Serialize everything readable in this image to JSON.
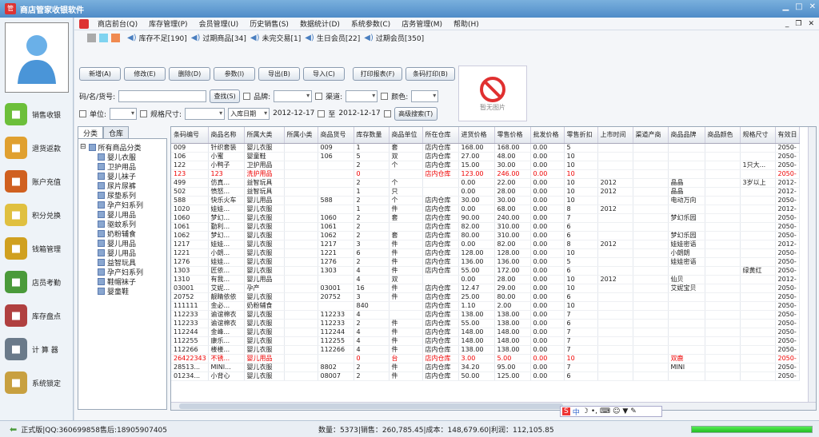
{
  "window": {
    "title": "商店管家收银软件"
  },
  "sidebar": {
    "items": [
      {
        "label": "销售收银",
        "icon": "sale-icon",
        "color": "#6cbf3a"
      },
      {
        "label": "退货返款",
        "icon": "boxes-icon",
        "color": "#e0a030"
      },
      {
        "label": "账户充值",
        "icon": "card-icon",
        "color": "#d06020"
      },
      {
        "label": "积分兑换",
        "icon": "pencil-icon",
        "color": "#e0c040"
      },
      {
        "label": "钱箱管理",
        "icon": "coins-icon",
        "color": "#d0a020"
      },
      {
        "label": "店员考勤",
        "icon": "people-icon",
        "color": "#4a9a3a"
      },
      {
        "label": "库存盘点",
        "icon": "house-icon",
        "color": "#b04040"
      },
      {
        "label": "计 算 器",
        "icon": "calculator-icon",
        "color": "#6a7a8a"
      },
      {
        "label": "系统锁定",
        "icon": "lock-icon",
        "color": "#c8a040"
      }
    ]
  },
  "menu": [
    "商店前台(Q)",
    "库存管理(P)",
    "会员管理(U)",
    "历史销售(S)",
    "数据统计(D)",
    "系统参数(C)",
    "店务管理(M)",
    "帮助(H)"
  ],
  "alerts": [
    "库存不足[190]",
    "过期商品[34]",
    "未完交易[1]",
    "生日会员[22]",
    "过期会员[350]"
  ],
  "toolbar": {
    "buttons": [
      "新增(A)",
      "修改(E)",
      "删除(D)",
      "参数(I)",
      "导出(B)",
      "导入(C)"
    ],
    "print_report": "打印报表(F)",
    "print_barcode": "条码打印(B)"
  },
  "filters": {
    "code_label": "码/名/货号:",
    "search": "查找(S)",
    "brand": "品牌:",
    "channel": "渠道:",
    "color": "颜色:",
    "unit": "单位:",
    "size": "规格尺寸:",
    "date_type": "入库日期",
    "date_from": "2012-12-17",
    "to": "至",
    "date_to": "2012-12-17",
    "advanced": "高级搜索(T)"
  },
  "big_icon_label": "暂无图片",
  "tabs": [
    "分类",
    "仓库"
  ],
  "tree": {
    "root": "所有商品分类",
    "children": [
      "婴儿衣服",
      "卫护用品",
      "婴儿袜子",
      "尿片尿裤",
      "尿垫系列",
      "孕产妇系列",
      "婴儿用品",
      "驱蚊系列",
      "奶粉辅食",
      "婴儿用品",
      "婴儿用品",
      "益智玩具",
      "孕产妇系列",
      "鞋帽袜子",
      "婴童鞋"
    ]
  },
  "table": {
    "headers": [
      "条码编号",
      "商品名称",
      "所属大类",
      "所属小类",
      "商品货号",
      "库存数量",
      "商品单位",
      "所在仓库",
      "进货价格",
      "零售价格",
      "批发价格",
      "零售折扣",
      "上市时间",
      "渠道产商",
      "商品品牌",
      "商品颜色",
      "规格尺寸",
      "有效日"
    ],
    "rows": [
      [
        "009",
        "针织套装",
        "婴儿衣服",
        "",
        "009",
        "1",
        "套",
        "店内仓库",
        "168.00",
        "168.00",
        "0.00",
        "5",
        "",
        "",
        "",
        "",
        "",
        "2050-"
      ],
      [
        "106",
        "小蜜",
        "婴童鞋",
        "",
        "106",
        "5",
        "双",
        "店内仓库",
        "27.00",
        "48.00",
        "0.00",
        "10",
        "",
        "",
        "",
        "",
        "",
        "2050-"
      ],
      [
        "122",
        "小鸭子",
        "卫护用品",
        "",
        "",
        "2",
        "个",
        "店内仓库",
        "15.00",
        "30.00",
        "0.00",
        "10",
        "",
        "",
        "",
        "",
        "1只大...",
        "2050-"
      ],
      [
        "123",
        "123",
        "洗护用品",
        "",
        "",
        "0",
        "",
        "店内仓库",
        "123.00",
        "246.00",
        "0.00",
        "10",
        "",
        "",
        "",
        "",
        "",
        "2050-"
      ],
      [
        "499",
        "仿真...",
        "益智玩具",
        "",
        "",
        "2",
        "个",
        "",
        "0.00",
        "22.00",
        "0.00",
        "10",
        "2012",
        "",
        "晶晶",
        "",
        "3岁以上",
        "2012-"
      ],
      [
        "502",
        "愤怒...",
        "益智玩具",
        "",
        "",
        "1",
        "只",
        "",
        "0.00",
        "28.00",
        "0.00",
        "10",
        "2012",
        "",
        "晶晶",
        "",
        "",
        "2012-"
      ],
      [
        "588",
        "快乐火车",
        "婴儿用品",
        "",
        "588",
        "2",
        "个",
        "店内仓库",
        "30.00",
        "30.00",
        "0.00",
        "10",
        "",
        "",
        "电动万向",
        "",
        "",
        "2050-"
      ],
      [
        "1020",
        "娃娃...",
        "婴儿衣服",
        "",
        "",
        "1",
        "件",
        "店内仓库",
        "0.00",
        "68.00",
        "0.00",
        "8",
        "2012",
        "",
        "",
        "",
        "",
        "2012-"
      ],
      [
        "1060",
        "梦幻...",
        "婴儿衣服",
        "",
        "1060",
        "2",
        "套",
        "店内仓库",
        "90.00",
        "240.00",
        "0.00",
        "7",
        "",
        "",
        "梦幻乐园",
        "",
        "",
        "2050-"
      ],
      [
        "1061",
        "勤利...",
        "婴儿衣服",
        "",
        "1061",
        "2",
        "",
        "店内仓库",
        "82.00",
        "310.00",
        "0.00",
        "6",
        "",
        "",
        "",
        "",
        "",
        "2050-"
      ],
      [
        "1062",
        "梦幻...",
        "婴儿衣服",
        "",
        "1062",
        "2",
        "套",
        "店内仓库",
        "80.00",
        "310.00",
        "0.00",
        "6",
        "",
        "",
        "梦幻乐园",
        "",
        "",
        "2050-"
      ],
      [
        "1217",
        "娃娃...",
        "婴儿衣服",
        "",
        "1217",
        "3",
        "件",
        "店内仓库",
        "0.00",
        "82.00",
        "0.00",
        "8",
        "2012",
        "",
        "娃娃密语",
        "",
        "",
        "2012-"
      ],
      [
        "1221",
        "小朗...",
        "婴儿衣服",
        "",
        "1221",
        "6",
        "件",
        "店内仓库",
        "128.00",
        "128.00",
        "0.00",
        "10",
        "",
        "",
        "小朗朗",
        "",
        "",
        "2050-"
      ],
      [
        "1276",
        "娃娃...",
        "婴儿衣服",
        "",
        "1276",
        "2",
        "件",
        "店内仓库",
        "136.00",
        "136.00",
        "0.00",
        "5",
        "",
        "",
        "娃娃密语",
        "",
        "",
        "2050-"
      ],
      [
        "1303",
        "匠依...",
        "婴儿衣服",
        "",
        "1303",
        "4",
        "件",
        "店内仓库",
        "55.00",
        "172.00",
        "0.00",
        "6",
        "",
        "",
        "",
        "",
        "绿黄红",
        "2050-"
      ],
      [
        "1310",
        "有我...",
        "婴儿用品",
        "",
        "",
        "4",
        "双",
        "",
        "0.00",
        "28.00",
        "0.00",
        "10",
        "2012",
        "",
        "仙贝",
        "",
        "",
        "2012-"
      ],
      [
        "03001",
        "艾妮...",
        "孕产",
        "",
        "03001",
        "16",
        "件",
        "店内仓库",
        "12.47",
        "29.00",
        "0.00",
        "10",
        "",
        "",
        "艾妮宝贝",
        "",
        "",
        "2050-"
      ],
      [
        "20752",
        "靓睛依依",
        "婴儿衣服",
        "",
        "20752",
        "3",
        "件",
        "店内仓库",
        "25.00",
        "80.00",
        "0.00",
        "6",
        "",
        "",
        "",
        "",
        "",
        "2050-"
      ],
      [
        "111111",
        "金必...",
        "奶粉辅食",
        "",
        "",
        "840",
        "",
        "店内仓库",
        "1.10",
        "2.00",
        "0.00",
        "10",
        "",
        "",
        "",
        "",
        "",
        "2050-"
      ],
      [
        "112233",
        "谕谊棉衣",
        "婴儿衣服",
        "",
        "112233",
        "4",
        "",
        "店内仓库",
        "138.00",
        "138.00",
        "0.00",
        "7",
        "",
        "",
        "",
        "",
        "",
        "2050-"
      ],
      [
        "112233",
        "谕谊棉衣",
        "婴儿衣服",
        "",
        "112233",
        "2",
        "件",
        "店内仓库",
        "55.00",
        "138.00",
        "0.00",
        "6",
        "",
        "",
        "",
        "",
        "",
        "2050-"
      ],
      [
        "112244",
        "金峰...",
        "婴儿衣服",
        "",
        "112244",
        "4",
        "件",
        "店内仓库",
        "148.00",
        "148.00",
        "0.00",
        "7",
        "",
        "",
        "",
        "",
        "",
        "2050-"
      ],
      [
        "112255",
        "康乐...",
        "婴儿衣服",
        "",
        "112255",
        "4",
        "件",
        "店内仓库",
        "148.00",
        "148.00",
        "0.00",
        "7",
        "",
        "",
        "",
        "",
        "",
        "2050-"
      ],
      [
        "112266",
        "楼楼...",
        "婴儿衣服",
        "",
        "112266",
        "4",
        "件",
        "店内仓库",
        "138.00",
        "138.00",
        "0.00",
        "7",
        "",
        "",
        "",
        "",
        "",
        "2050-"
      ],
      [
        "26422343",
        "不锈...",
        "婴儿用品",
        "",
        "",
        "0",
        "台",
        "店内仓库",
        "3.00",
        "5.00",
        "0.00",
        "10",
        "",
        "",
        "双鹿",
        "",
        "",
        "2050-"
      ],
      [
        "28513...",
        "MINI...",
        "婴儿衣服",
        "",
        "8802",
        "2",
        "件",
        "店内仓库",
        "34.20",
        "95.00",
        "0.00",
        "7",
        "",
        "",
        "MINI",
        "",
        "",
        "2050-"
      ],
      [
        "01234...",
        "小背心",
        "婴儿衣服",
        "",
        "08007",
        "2",
        "件",
        "店内仓库",
        "50.00",
        "125.00",
        "0.00",
        "6",
        "",
        "",
        "",
        "",
        "",
        "2050-"
      ]
    ],
    "red_rows": [
      3,
      24
    ]
  },
  "ime": "中",
  "status": {
    "version": "正式版|QQ:360699858售后:18905907405",
    "stats": "数量：5373|销售：260,785.45|成本：148,679.60|利润：112,105.85",
    "progress": 1.0
  }
}
